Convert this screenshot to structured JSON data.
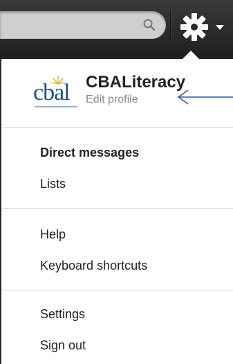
{
  "profile": {
    "logo_text": "cbal",
    "name": "CBALiteracy",
    "edit_label": "Edit profile"
  },
  "menu": {
    "direct_messages": "Direct messages",
    "lists": "Lists",
    "help": "Help",
    "keyboard_shortcuts": "Keyboard shortcuts",
    "settings": "Settings",
    "sign_out": "Sign out"
  },
  "icons": {
    "search": "search-icon",
    "settings": "gear-icon",
    "dropdown": "chevron-down-icon"
  },
  "colors": {
    "topbar": "#2a2a2a",
    "logo": "#1e4d85",
    "annotation": "#2f5597"
  }
}
